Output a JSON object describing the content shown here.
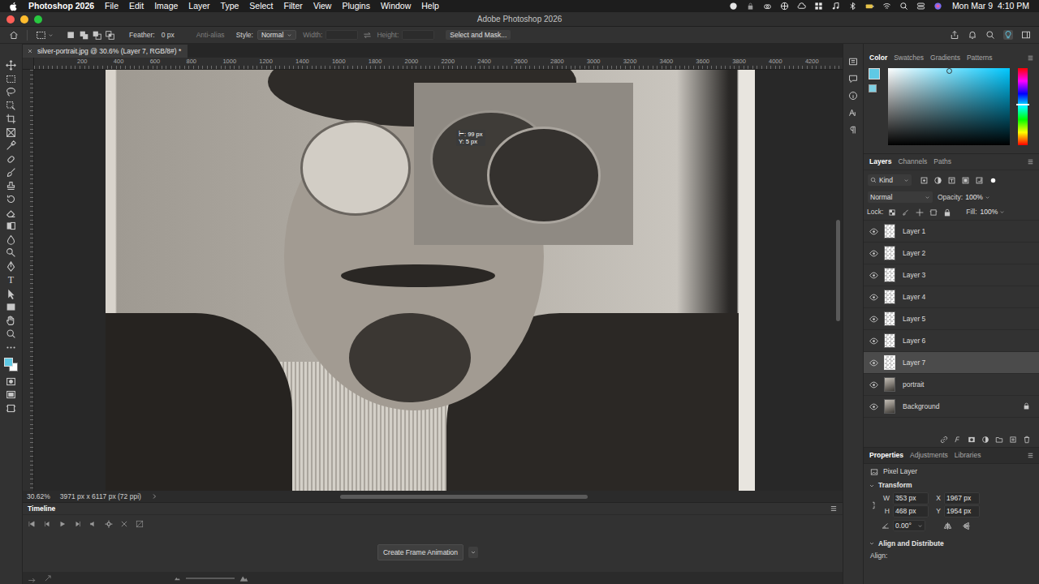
{
  "menubar": {
    "app": "Photoshop 2026",
    "menus": [
      "File",
      "Edit",
      "Image",
      "Layer",
      "Type",
      "Select",
      "Filter",
      "View",
      "Plugins",
      "Window",
      "Help"
    ],
    "clock": "Mon Mar 9  4:10 PM"
  },
  "window": {
    "title": "Adobe Photoshop 2026"
  },
  "options": {
    "feather": {
      "label": "Feather:",
      "value": "0 px"
    },
    "antialias": {
      "label": "Anti-alias",
      "disabled": true
    },
    "style": {
      "label": "Style:",
      "value": "Normal"
    },
    "width": {
      "label": "Width:",
      "disabled": true
    },
    "height": {
      "label": "Height:",
      "disabled": true
    },
    "select_and_mask": "Select and Mask..."
  },
  "document": {
    "tab": "silver-portrait.jpg @ 30.6% (Layer 7, RGB/8#) *"
  },
  "toolbar": {
    "type_tool": "T"
  },
  "ruler": {
    "top": [
      "200",
      "400",
      "600",
      "800",
      "1000",
      "1200",
      "1400",
      "1600",
      "1800",
      "2000",
      "2200",
      "2400",
      "2600",
      "2800",
      "3000",
      "3200",
      "3400",
      "3600",
      "3800",
      "4000",
      "4200"
    ]
  },
  "canvas": {
    "tooltip": [
      "⊢: 99 px",
      "Y: 5 px"
    ]
  },
  "status": {
    "zoom": "30.62%",
    "size": "3971 px x 6117 px (72 ppi)"
  },
  "timeline": {
    "title": "Timeline",
    "button": "Create Frame Animation"
  },
  "color_panel": {
    "tabs": [
      {
        "label": "Color",
        "selected": true
      },
      {
        "label": "Swatches",
        "selected": false
      },
      {
        "label": "Gradients",
        "selected": false
      },
      {
        "label": "Patterns",
        "selected": false
      }
    ]
  },
  "layers_panel": {
    "tabs": [
      {
        "label": "Layers",
        "selected": true
      },
      {
        "label": "Channels",
        "selected": false
      },
      {
        "label": "Paths",
        "selected": false
      }
    ],
    "filter": "Kind",
    "blend_mode": "Normal",
    "opacity": {
      "label": "Opacity:",
      "value": "100%"
    },
    "lock_label": "Lock:",
    "fill": {
      "label": "Fill:",
      "value": "100%"
    },
    "layers": [
      {
        "name": "Layer 1",
        "visible": true,
        "selected": false,
        "locked": false,
        "kind": "transparent"
      },
      {
        "name": "Layer 2",
        "visible": true,
        "selected": false,
        "locked": false,
        "kind": "transparent"
      },
      {
        "name": "Layer 3",
        "visible": true,
        "selected": false,
        "locked": false,
        "kind": "transparent"
      },
      {
        "name": "Layer 4",
        "visible": true,
        "selected": false,
        "locked": false,
        "kind": "transparent"
      },
      {
        "name": "Layer 5",
        "visible": true,
        "selected": false,
        "locked": false,
        "kind": "transparent"
      },
      {
        "name": "Layer 6",
        "visible": true,
        "selected": false,
        "locked": false,
        "kind": "transparent"
      },
      {
        "name": "Layer 7",
        "visible": true,
        "selected": true,
        "locked": false,
        "kind": "transparent"
      },
      {
        "name": "portrait",
        "visible": true,
        "selected": false,
        "locked": false,
        "kind": "image"
      },
      {
        "name": "Background",
        "visible": true,
        "selected": false,
        "locked": true,
        "kind": "image"
      }
    ]
  },
  "properties": {
    "tabs": [
      {
        "label": "Properties",
        "selected": true
      },
      {
        "label": "Adjustments",
        "selected": false
      },
      {
        "label": "Libraries",
        "selected": false
      }
    ],
    "layer_type": "Pixel Layer",
    "transform": {
      "title": "Transform",
      "expanded": true,
      "w": {
        "label": "W",
        "value": "353 px"
      },
      "h": {
        "label": "H",
        "value": "468 px"
      },
      "x": {
        "label": "X",
        "value": "1967 px"
      },
      "y": {
        "label": "Y",
        "value": "1954 px"
      },
      "angle": "0.00°"
    },
    "align": {
      "title": "Align and Distribute",
      "expanded": true,
      "label": "Align:"
    }
  }
}
